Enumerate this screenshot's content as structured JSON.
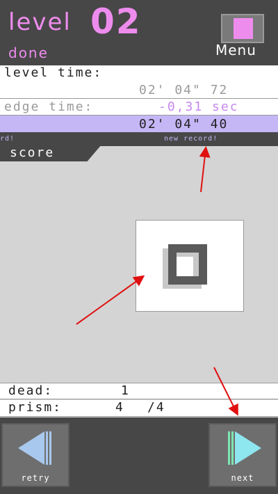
{
  "header": {
    "level_label": "level",
    "level_number": "02",
    "status": "done",
    "menu_label": "Menu"
  },
  "times": {
    "level_time_label": "level time:",
    "level_time_value": "02'  04\"  72",
    "edge_time_label": "edge time:",
    "edge_time_value": "-0,31  sec",
    "record_value": "02'  04\"  40"
  },
  "record_strip": {
    "left_text": "rd!",
    "right_text": "new record!"
  },
  "score": {
    "tab_label": "score",
    "grade_icon": "grade-d-icon"
  },
  "stats": {
    "dead_label": "dead:",
    "dead_value": "1",
    "prism_label": "prism:",
    "prism_collected": "4",
    "prism_total": "/4"
  },
  "nav": {
    "retry_label": "retry",
    "next_label": "next"
  },
  "colors": {
    "accent_pink": "#ee8cee",
    "record_bg": "#c5b6f6",
    "panel_dark": "#474747",
    "annotation_red": "#e01010"
  }
}
